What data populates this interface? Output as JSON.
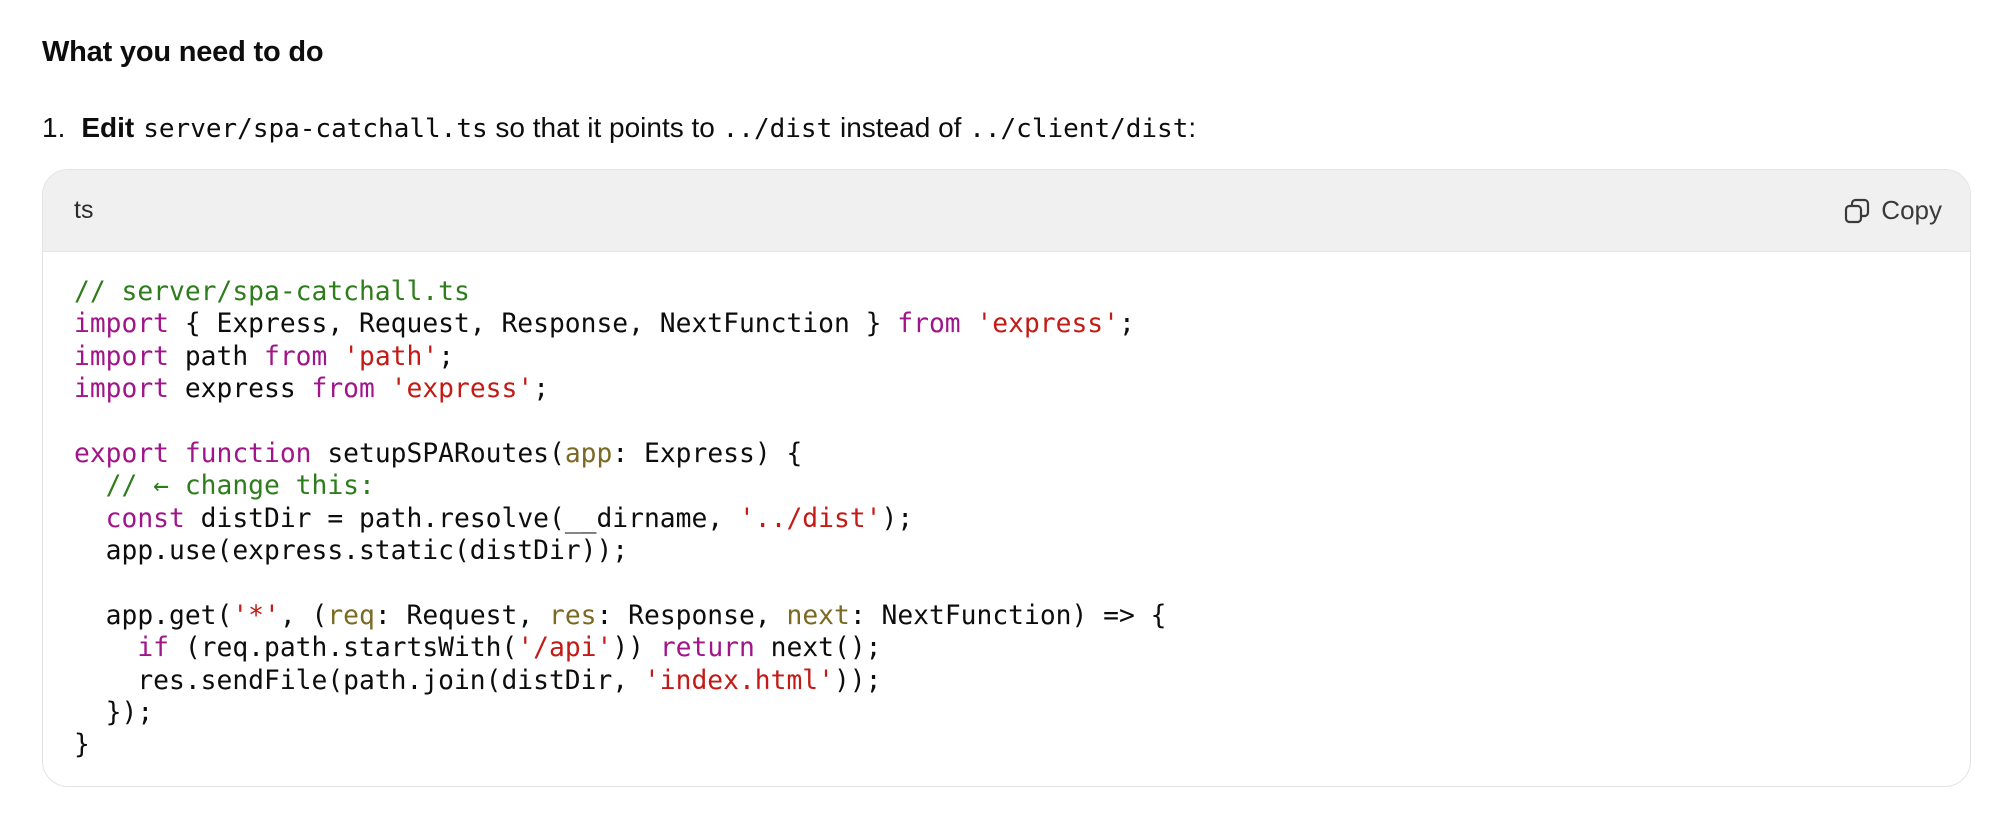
{
  "heading": "What you need to do",
  "step": {
    "number": "1.",
    "bold": "Edit",
    "file": "server/spa-catchall.ts",
    "text1": " so that it points to ",
    "new_path": "../dist",
    "text2": " instead of ",
    "old_path": "../client/dist",
    "text3": ":"
  },
  "code_block": {
    "language": "ts",
    "copy_label": "Copy",
    "copy_icon": "copy-icon",
    "colors": {
      "comment": "#2e7d1c",
      "keyword": "#a0168a",
      "string": "#c41a16",
      "param": "#7b6a22"
    },
    "lines": [
      [
        {
          "t": "comment",
          "v": "// server/spa-catchall.ts"
        }
      ],
      [
        {
          "t": "keyword",
          "v": "import"
        },
        {
          "t": "plain",
          "v": " { Express, Request, Response, NextFunction } "
        },
        {
          "t": "keyword",
          "v": "from"
        },
        {
          "t": "plain",
          "v": " "
        },
        {
          "t": "string",
          "v": "'express'"
        },
        {
          "t": "plain",
          "v": ";"
        }
      ],
      [
        {
          "t": "keyword",
          "v": "import"
        },
        {
          "t": "plain",
          "v": " path "
        },
        {
          "t": "keyword",
          "v": "from"
        },
        {
          "t": "plain",
          "v": " "
        },
        {
          "t": "string",
          "v": "'path'"
        },
        {
          "t": "plain",
          "v": ";"
        }
      ],
      [
        {
          "t": "keyword",
          "v": "import"
        },
        {
          "t": "plain",
          "v": " express "
        },
        {
          "t": "keyword",
          "v": "from"
        },
        {
          "t": "plain",
          "v": " "
        },
        {
          "t": "string",
          "v": "'express'"
        },
        {
          "t": "plain",
          "v": ";"
        }
      ],
      [],
      [
        {
          "t": "keyword",
          "v": "export"
        },
        {
          "t": "plain",
          "v": " "
        },
        {
          "t": "keyword",
          "v": "function"
        },
        {
          "t": "plain",
          "v": " setupSPARoutes("
        },
        {
          "t": "param",
          "v": "app"
        },
        {
          "t": "plain",
          "v": ": Express) {"
        }
      ],
      [
        {
          "t": "plain",
          "v": "  "
        },
        {
          "t": "comment",
          "v": "// ← change this:"
        }
      ],
      [
        {
          "t": "plain",
          "v": "  "
        },
        {
          "t": "keyword",
          "v": "const"
        },
        {
          "t": "plain",
          "v": " distDir = path.resolve(__dirname, "
        },
        {
          "t": "string",
          "v": "'../dist'"
        },
        {
          "t": "plain",
          "v": ");"
        }
      ],
      [
        {
          "t": "plain",
          "v": "  app.use(express.static(distDir));"
        }
      ],
      [],
      [
        {
          "t": "plain",
          "v": "  app.get("
        },
        {
          "t": "string",
          "v": "'*'"
        },
        {
          "t": "plain",
          "v": ", ("
        },
        {
          "t": "param",
          "v": "req"
        },
        {
          "t": "plain",
          "v": ": Request, "
        },
        {
          "t": "param",
          "v": "res"
        },
        {
          "t": "plain",
          "v": ": Response, "
        },
        {
          "t": "param",
          "v": "next"
        },
        {
          "t": "plain",
          "v": ": NextFunction) => {"
        }
      ],
      [
        {
          "t": "plain",
          "v": "    "
        },
        {
          "t": "keyword",
          "v": "if"
        },
        {
          "t": "plain",
          "v": " (req.path.startsWith("
        },
        {
          "t": "string",
          "v": "'/api'"
        },
        {
          "t": "plain",
          "v": ")) "
        },
        {
          "t": "keyword",
          "v": "return"
        },
        {
          "t": "plain",
          "v": " next();"
        }
      ],
      [
        {
          "t": "plain",
          "v": "    res.sendFile(path.join(distDir, "
        },
        {
          "t": "string",
          "v": "'index.html'"
        },
        {
          "t": "plain",
          "v": "));"
        }
      ],
      [
        {
          "t": "plain",
          "v": "  });"
        }
      ],
      [
        {
          "t": "plain",
          "v": "}"
        }
      ]
    ]
  }
}
